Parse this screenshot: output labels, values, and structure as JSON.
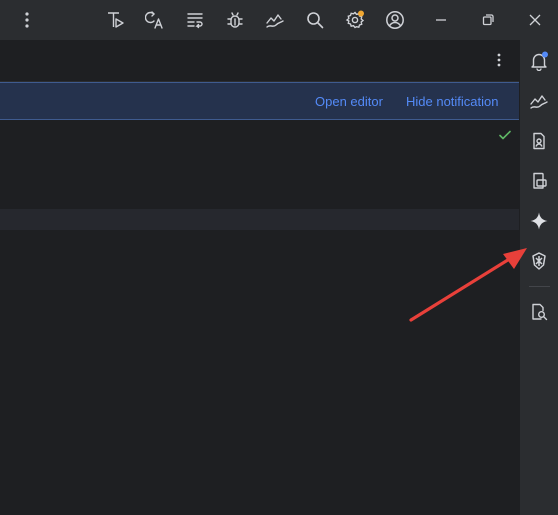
{
  "titlebar": {
    "icons": [
      "more-vertical-icon",
      "run-test-icon",
      "translate-icon",
      "commit-icon",
      "debug-icon",
      "profiler-icon",
      "search-icon",
      "settings-icon",
      "account-icon"
    ],
    "window_controls": [
      "minimize-icon",
      "restore-icon",
      "close-icon"
    ],
    "settings_badge_color": "#f0a732"
  },
  "editor_tabs": {
    "menu_icon": "more-vertical-icon"
  },
  "notification": {
    "open_editor_label": "Open editor",
    "hide_notification_label": "Hide notification",
    "link_color": "#548af7",
    "background_color": "#25324d"
  },
  "editor": {
    "status_icon": "checkmark-icon",
    "status_color": "#5fb865"
  },
  "right_toolbar": {
    "tools": [
      "notifications-icon",
      "profiler-icon",
      "device-manager-icon",
      "running-devices-icon",
      "gemini-icon",
      "app-quality-insights-icon",
      "logcat-search-icon"
    ],
    "notification_badge_color": "#548af7"
  },
  "annotation": {
    "arrow_color": "#e8403a"
  }
}
